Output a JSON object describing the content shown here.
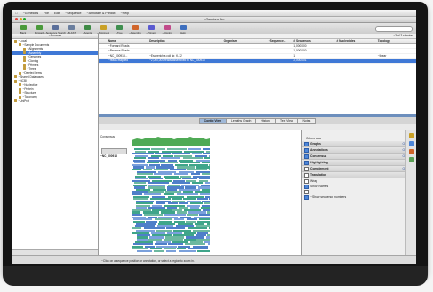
{
  "menubar": {
    "apple": "",
    "items": [
      "~Geneious",
      "File",
      "Edit",
      "~Sequence",
      "~Annotate & Predict",
      "~Help"
    ],
    "right": [
      "",
      "",
      ""
    ]
  },
  "window": {
    "title": "~Geneious Pro"
  },
  "toolbar": {
    "buttons": [
      {
        "label": "Back",
        "color": "#4a9a3b"
      },
      {
        "label": "Forward",
        "color": "#4a9a3b"
      },
      {
        "label": "~Sequence Search",
        "color": "#5a6f9a"
      },
      {
        "label": "~BLAST",
        "color": "#6a7e9e"
      },
      {
        "label": "~Agents",
        "color": "#3e8a45"
      },
      {
        "label": "~Alignment",
        "color": "#c9a026"
      },
      {
        "label": "~Tree",
        "color": "#3f8f4f"
      },
      {
        "label": "~Assembly",
        "color": "#d0652a"
      },
      {
        "label": "~Primers",
        "color": "#5a5ad0"
      },
      {
        "label": "~Cloning",
        "color": "#c14a8a"
      },
      {
        "label": "Help",
        "color": "#3e6fbe"
      }
    ]
  },
  "sidebar": {
    "header": "~Sources",
    "items": [
      {
        "label": "~Local",
        "indent": 0,
        "selected": false
      },
      {
        "label": "~Sample Documents",
        "indent": 1,
        "selected": false
      },
      {
        "label": "~Alignments",
        "indent": 2,
        "selected": false
      },
      {
        "label": "~Assembly",
        "indent": 2,
        "selected": true
      },
      {
        "label": "~Genomes",
        "indent": 2,
        "selected": false
      },
      {
        "label": "~Cloning",
        "indent": 2,
        "selected": false
      },
      {
        "label": "~Primers",
        "indent": 2,
        "selected": false
      },
      {
        "label": "~Trees",
        "indent": 2,
        "selected": false
      },
      {
        "label": "~Deleted Items",
        "indent": 1,
        "selected": false
      },
      {
        "label": "~Shared Databases",
        "indent": 0,
        "selected": false
      },
      {
        "label": "~NCBI",
        "indent": 0,
        "selected": false
      },
      {
        "label": "~Nucleotide",
        "indent": 1,
        "selected": false
      },
      {
        "label": "~Protein",
        "indent": 1,
        "selected": false
      },
      {
        "label": "~Structure",
        "indent": 1,
        "selected": false
      },
      {
        "label": "~Taxonomy",
        "indent": 1,
        "selected": false
      },
      {
        "label": "~UniProt",
        "indent": 0,
        "selected": false
      }
    ],
    "footer": ""
  },
  "doc_table": {
    "status": "~3 of 3 selected",
    "columns": [
      "",
      "Name",
      "Description",
      "Organism",
      "~Sequence...",
      "# Sequences",
      "# Nucleotides",
      "Topology"
    ],
    "rows": [
      {
        "cells": [
          "",
          "~Forward Reads",
          "",
          "",
          "",
          "1,000,000",
          "",
          ""
        ],
        "selected": false
      },
      {
        "cells": [
          "",
          "~Reverse Reads",
          "",
          "",
          "",
          "1,000,000",
          "",
          ""
        ],
        "selected": false
      },
      {
        "cells": [
          "",
          "~NC_000913...",
          "~Escherichia coli str. K-12",
          "",
          "",
          "1",
          "",
          "~linear"
        ],
        "selected": false
      },
      {
        "cells": [
          "",
          "~reads mapped",
          "~2,000,000 reads assembled to NC_000913",
          "",
          "",
          "2,000,001",
          "",
          ""
        ],
        "selected": true
      }
    ]
  },
  "view_tabs": [
    {
      "label": "Contig View",
      "active": true
    },
    {
      "label": "Lengths Graph",
      "active": false
    },
    {
      "label": "History",
      "active": false
    },
    {
      "label": "Text View",
      "active": false
    },
    {
      "label": "Notes",
      "active": false
    }
  ],
  "view_toolbar": [
    "",
    "",
    "",
    "",
    "",
    ""
  ],
  "viewer": {
    "consensus_label": "Consensus",
    "coverage_label": "",
    "reference_label": "~NC_000913",
    "zoom_label": ""
  },
  "settings": {
    "top_label": "",
    "colors_label": "~Colors",
    "colors_value": "",
    "sections": [
      {
        "label": "Graphs",
        "checked": true,
        "options": "Options »"
      },
      {
        "label": "Annotations",
        "checked": true,
        "options": "Options »"
      },
      {
        "label": "Consensus",
        "checked": true,
        "options": "Options »"
      },
      {
        "label": "Highlighting",
        "checked": true,
        "options": ""
      },
      {
        "label": "Complement",
        "checked": false,
        "options": "Options »"
      },
      {
        "label": "Translation",
        "checked": false,
        "options": ""
      }
    ],
    "wrap_label": "Wrap",
    "show_names_label": "Show Names",
    "show_label": "",
    "show_sequence_numbers_label": "~Show sequence numbers"
  },
  "statusbar": {
    "text": "~Click on a sequence position or annotation, or select a region to zoom in."
  },
  "colors": {
    "accent": "#3f78d6",
    "reads_forward": "#3fa58a",
    "reads_reverse": "#4f7fc9",
    "coverage": "#4faa55"
  }
}
